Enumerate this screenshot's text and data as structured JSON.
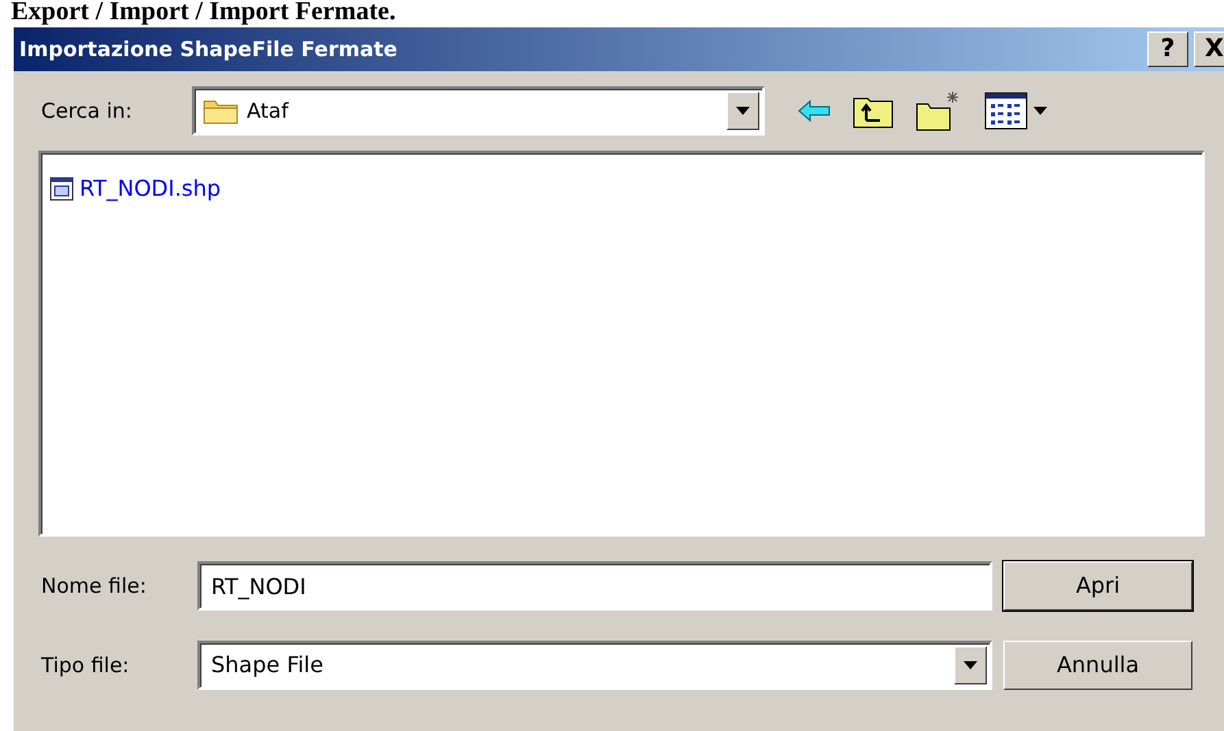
{
  "page_heading": "Export / Import / Import Fermate.",
  "window": {
    "title": "Importazione ShapeFile Fermate",
    "title_buttons": [
      "?",
      "X"
    ]
  },
  "look_in": {
    "label": "Cerca in:",
    "value": "Ataf"
  },
  "files": [
    {
      "name": "RT_NODI.shp",
      "selected": false
    }
  ],
  "file_name": {
    "label": "Nome file:",
    "value": "RT_NODI"
  },
  "file_type": {
    "label": "Tipo file:",
    "value": "Shape File"
  },
  "buttons": [
    {
      "label": "Apri",
      "default": true
    },
    {
      "label": "Annulla",
      "default": false
    }
  ]
}
